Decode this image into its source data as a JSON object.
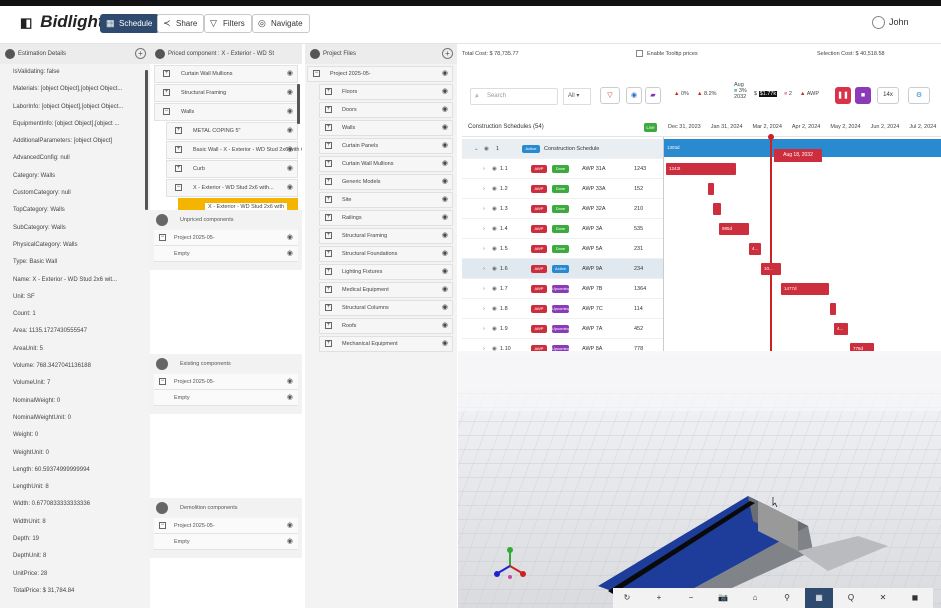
{
  "header": {
    "logo_text": "Bidlight",
    "buttons": [
      {
        "label": "Schedule",
        "icon": "calendar-icon"
      },
      {
        "label": "Share",
        "icon": "share-icon"
      },
      {
        "label": "Filters",
        "icon": "filter-icon"
      },
      {
        "label": "Navigate",
        "icon": "compass-icon"
      }
    ],
    "user_name": "John"
  },
  "estimation": {
    "title": "Estimation Details",
    "rows": [
      "IsValidating: false",
      "Materials: [object Object],[object Object...",
      "LaborInfo: [object Object],[object Object...",
      "EquipmentInfo: [object Object],[object ...",
      "AdditionalParameters: [object Object]",
      "AdvancedConfig: null",
      "Category: Walls",
      "CustomCategory: null",
      "TopCategory: Walls",
      "SubCategory: Walls",
      "PhysicalCategory: Walls",
      "Type: Basic Wall",
      "Name: X - Exterior - WD Stud 2x6 wit...",
      "Unit: SF",
      "Count: 1",
      "Area: 1135.1727430555547",
      "AreaUnit: 5",
      "Volume: 768.3427041136188",
      "VolumeUnit: 7",
      "NominalWeight: 0",
      "NominalWeightUnit: 0",
      "Weight: 0",
      "WeightUnit: 0",
      "Length: 60.59374999999994",
      "LengthUnit: 8",
      "Width: 0.6770833333333336",
      "WidthUnit: 8",
      "Depth: 19",
      "DepthUnit: 8",
      "UnitPrice: 28",
      "TotalPrice: $ 31,784.84"
    ]
  },
  "priced": {
    "title": "Priced component : X - Exterior - WD St",
    "items": [
      {
        "label": "Curtain Wall Mullions",
        "exp": "+"
      },
      {
        "label": "Structural Framing",
        "exp": "+"
      },
      {
        "label": "Walls",
        "exp": "−"
      },
      {
        "label": "METAL COPING 5\"",
        "exp": "+"
      },
      {
        "label": "Basic Wall - X - Exterior - WD Stud 2x6 with C",
        "exp": "+"
      },
      {
        "label": "Curb",
        "exp": "+"
      },
      {
        "label": "X - Exterior - WD Stud 2x6 with...",
        "exp": "−"
      },
      {
        "label": "X - Exterior - WD Stud 2x6 with",
        "exp": ""
      }
    ],
    "unpriced_title": "Unpriced components",
    "existing_title": "Existing components",
    "demolition_title": "Demolition components",
    "project_label": "Project 2025-05-",
    "empty_label": "Empty"
  },
  "project_files": {
    "title": "Project Files",
    "root": "Project 2025-05-",
    "items": [
      "Floors",
      "Doors",
      "Walls",
      "Curtain Panels",
      "Curtain Wall Mullions",
      "Generic Models",
      "Site",
      "Railings",
      "Structural Framing",
      "Structural Foundations",
      "Lighting Fixtures",
      "Medical Equipment",
      "Structural Columns",
      "Roofs",
      "Mechanical Equipment"
    ]
  },
  "gantt_info": {
    "total_cost": "Total Cost: $ 78,735.77",
    "tooltip_label": "Enable Tooltip prices",
    "selection_cost": "Selection Cost: $ 40,518.58"
  },
  "toolbar": {
    "search_placeholder": "Search",
    "all_label": "All",
    "stat1": "0%",
    "stat2": "8.2%",
    "stat3_top": "Aug",
    "stat3": "3%",
    "stat3_bottom": "2032",
    "stat4": "$1.77k",
    "stat5": "2",
    "stat6": "AWP",
    "zoom": "14x"
  },
  "schedule": {
    "title": "Construction Schedules (54)",
    "live": "Live",
    "dates": [
      "Dec 31, 2023",
      "Jan 31, 2024",
      "Mar 2, 2024",
      "Apr 2, 2024",
      "May 2, 2024",
      "Jun 2, 2024",
      "Jul 2, 2024"
    ],
    "root": {
      "num": "1",
      "status": "Active",
      "name": "Construction Schedule",
      "bar_label": "1303d",
      "flag": "Aug 18, 2032"
    },
    "rows": [
      {
        "num": "1.1",
        "status": "Done",
        "name": "AWP 31A",
        "qty": "1243",
        "bar": "1243t"
      },
      {
        "num": "1.2",
        "status": "Done",
        "name": "AWP 33A",
        "qty": "152",
        "bar": ""
      },
      {
        "num": "1.3",
        "status": "Done",
        "name": "AWP 32A",
        "qty": "210",
        "bar": ""
      },
      {
        "num": "1.4",
        "status": "Done",
        "name": "AWP 3A",
        "qty": "535",
        "bar": "985d"
      },
      {
        "num": "1.5",
        "status": "Done",
        "name": "AWP 5A",
        "qty": "231",
        "bar": "4..."
      },
      {
        "num": "1.6",
        "status": "Active",
        "name": "AWP 9A",
        "qty": "234",
        "bar": "10..."
      },
      {
        "num": "1.7",
        "status": "Upcoming",
        "name": "AWP 7B",
        "qty": "1364",
        "bar": "1477d"
      },
      {
        "num": "1.8",
        "status": "Upcoming",
        "name": "AWP 7C",
        "qty": "114",
        "bar": ""
      },
      {
        "num": "1.9",
        "status": "Upcoming",
        "name": "AWP 7A",
        "qty": "452",
        "bar": "4..."
      },
      {
        "num": "1.10",
        "status": "Upcoming",
        "name": "AWP 8A",
        "qty": "778",
        "bar": "778d"
      }
    ]
  },
  "viewer_toolbar": [
    "↻",
    "+",
    "−",
    "📷",
    "⌂",
    "⚲",
    "▦",
    "Q",
    "✕",
    "◼"
  ]
}
